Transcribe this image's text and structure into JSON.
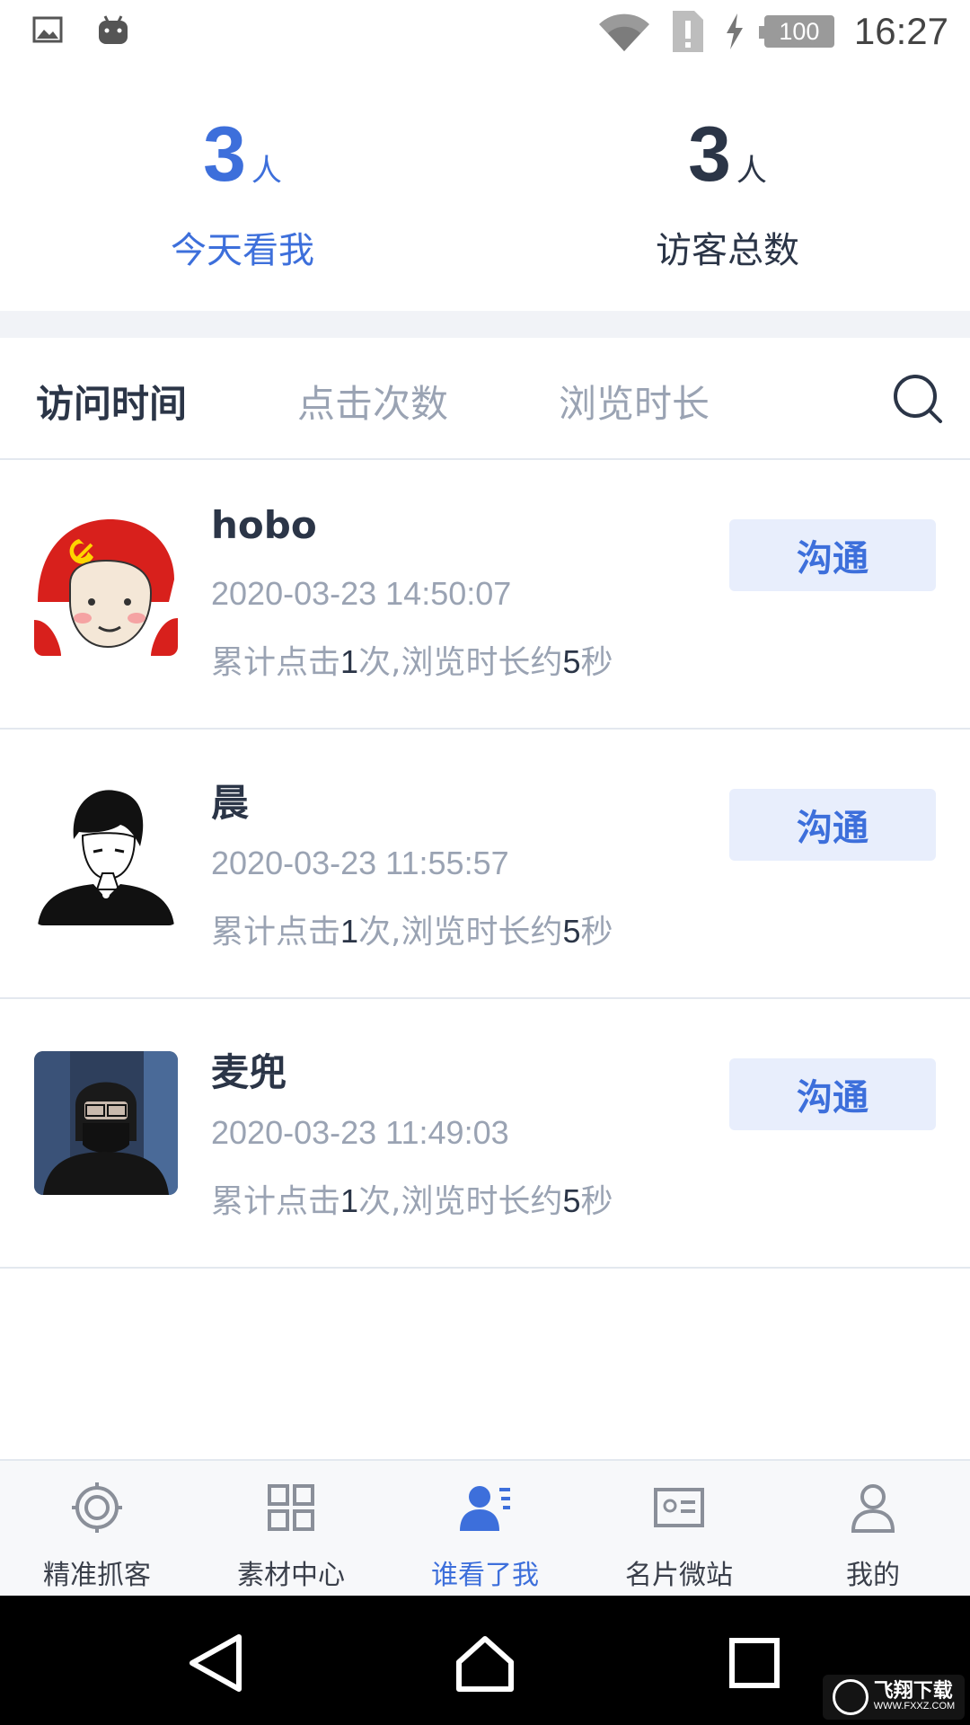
{
  "status_bar": {
    "time": "16:27",
    "battery": "100",
    "icons": [
      "image-icon",
      "android-icon",
      "wifi-icon",
      "sim-alert-icon",
      "charging-icon",
      "battery-icon"
    ]
  },
  "stats": {
    "today": {
      "value": "3",
      "unit": "人",
      "label": "今天看我"
    },
    "total": {
      "value": "3",
      "unit": "人",
      "label": "访客总数"
    }
  },
  "tabs": [
    {
      "label": "访问时间",
      "active": true
    },
    {
      "label": "点击次数",
      "active": false
    },
    {
      "label": "浏览时长",
      "active": false
    }
  ],
  "visitors": [
    {
      "name": "hobo",
      "time": "2020-03-23 14:50:07",
      "summary_prefix": "累计点击",
      "clicks": "1",
      "summary_mid": "次,浏览时长约",
      "duration": "5",
      "summary_suffix": "秒",
      "button": "沟通",
      "avatar": "cartoon-meme-avatar"
    },
    {
      "name": "晨",
      "time": "2020-03-23 11:55:57",
      "summary_prefix": "累计点击",
      "clicks": "1",
      "summary_mid": "次,浏览时长约",
      "duration": "5",
      "summary_suffix": "秒",
      "button": "沟通",
      "avatar": "anime-boy-avatar"
    },
    {
      "name": "麦兜",
      "time": "2020-03-23 11:49:03",
      "summary_prefix": "累计点击",
      "clicks": "1",
      "summary_mid": "次,浏览时长约",
      "duration": "5",
      "summary_suffix": "秒",
      "button": "沟通",
      "avatar": "photo-avatar"
    }
  ],
  "bottom_nav": [
    {
      "label": "精准抓客",
      "icon": "target-icon",
      "active": false
    },
    {
      "label": "素材中心",
      "icon": "grid-icon",
      "active": false
    },
    {
      "label": "谁看了我",
      "icon": "visitors-icon",
      "active": true
    },
    {
      "label": "名片微站",
      "icon": "card-icon",
      "active": false
    },
    {
      "label": "我的",
      "icon": "profile-icon",
      "active": false
    }
  ],
  "watermark": {
    "text": "飞翔下载",
    "sub": "WWW.FXXZ.COM"
  },
  "colors": {
    "accent": "#3d6fdb",
    "dark_text": "#2b3547",
    "muted_text": "#9aa3b3",
    "button_bg": "#e8eefc"
  }
}
